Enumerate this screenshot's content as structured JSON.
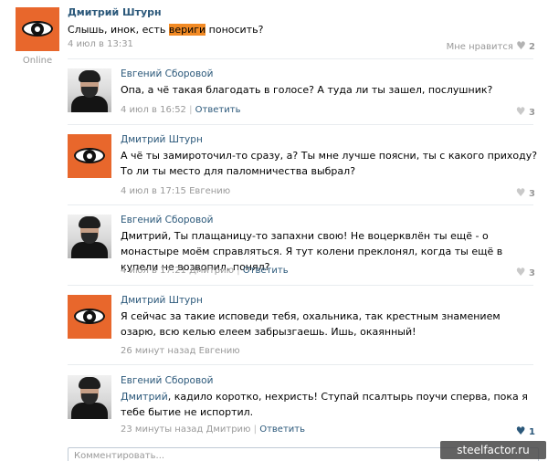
{
  "post": {
    "author": "Дмитрий Штурн",
    "text_before": "Слышь, инок, есть ",
    "text_highlight": "вериги",
    "text_after": " поносить?",
    "date": "4 июл в 13:31",
    "online": "Online",
    "like_label": "Мне нравится",
    "like_count": "2"
  },
  "replies": [
    {
      "author": "Евгений Сборовой",
      "text": "Опа, а чё такая благодать в голосе? А туда ли ты зашел, послушник?",
      "date": "4 июл в 16:52",
      "sep": "|",
      "action": "Ответить",
      "likes": "3"
    },
    {
      "author": "Дмитрий Штурн",
      "text": "А чё ты замироточил-то сразу, а? Ты мне лучше поясни, ты с какого приходу? То ли ты место для паломничества выбрал?",
      "date": "4 июл в 17:15",
      "to": "Евгению",
      "likes": "3"
    },
    {
      "author": "Евгений Сборовой",
      "text": "Дмитрий, Ты плащаницу-то запахни свою! Не воцерквлён ты ещё - о монастыре моём справляться. Я тут колени преклонял, когда ты ещё в купели не возвопил, понял?",
      "date": "4 июл в 17:21",
      "to": "Дмитрию",
      "sep": "|",
      "action": "Ответить",
      "likes": "3"
    },
    {
      "author": "Дмитрий Штурн",
      "text": "Я сейчас за такие исповеди тебя, охальника, так крестным знамением озарю, всю келью елеем забрызгаешь. Ишь, окаянный!",
      "date": "26 минут назад",
      "to": "Евгению"
    },
    {
      "author": "Евгений Сборовой",
      "name_ref": "Дмитрий",
      "text": ", кадило коротко, нехристь! Ступай псалтырь поучи сперва, пока я тебе бытие не испортил.",
      "date": "23 минуты назад",
      "to": "Дмитрию",
      "sep": "|",
      "action": "Ответить",
      "likes": "1"
    }
  ],
  "comment_placeholder": "Комментировать...",
  "watermark": "steelfactor.ru",
  "icons": {
    "like": "heart-icon"
  },
  "colors": {
    "accent": "#2b587a",
    "avatar_orange": "#e8672c",
    "highlight": "#f28a24"
  }
}
